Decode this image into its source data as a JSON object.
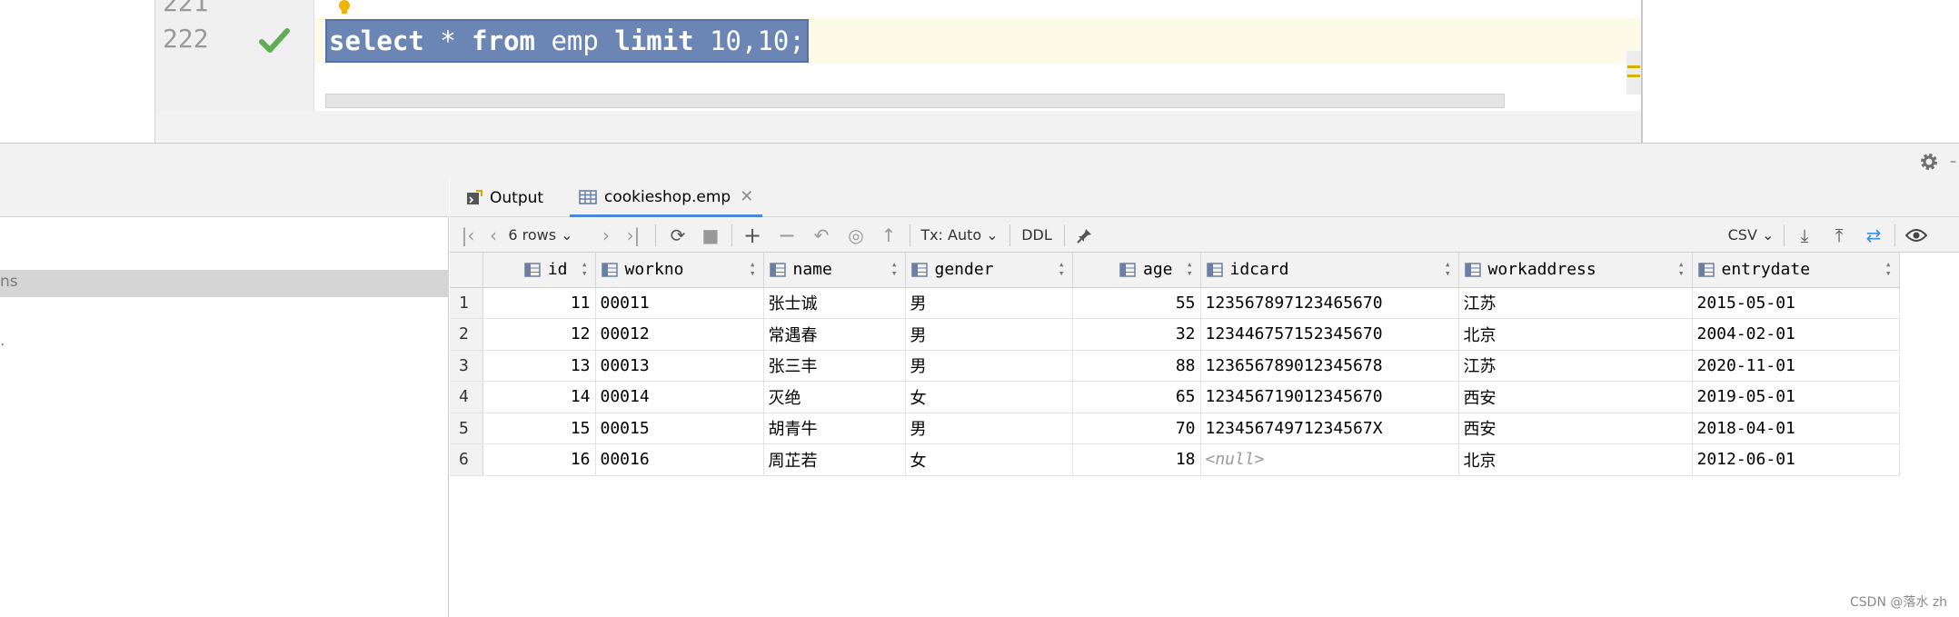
{
  "editor": {
    "line_prev": "221",
    "line_current": "222",
    "sql": {
      "kw_select": "select",
      "star": " * ",
      "kw_from": "from",
      "table": " emp ",
      "kw_limit": "limit",
      "args": " 10,10",
      "end": ";"
    }
  },
  "tabs": {
    "output": "Output",
    "result": "cookieshop.emp",
    "close": "✕"
  },
  "toolbar": {
    "rows": "6 rows",
    "tx": "Tx: Auto",
    "ddl": "DDL",
    "csv": "CSV"
  },
  "left_panel": {
    "frag1": "ns",
    "frag2": "."
  },
  "table": {
    "columns": [
      "id",
      "workno",
      "name",
      "gender",
      "age",
      "idcard",
      "workaddress",
      "entrydate"
    ],
    "rows": [
      {
        "n": "1",
        "id": "11",
        "workno": "00011",
        "name": "张士诚",
        "gender": "男",
        "age": "55",
        "idcard": "123567897123465670",
        "workaddress": "江苏",
        "entrydate": "2015-05-01"
      },
      {
        "n": "2",
        "id": "12",
        "workno": "00012",
        "name": "常遇春",
        "gender": "男",
        "age": "32",
        "idcard": "123446757152345670",
        "workaddress": "北京",
        "entrydate": "2004-02-01"
      },
      {
        "n": "3",
        "id": "13",
        "workno": "00013",
        "name": "张三丰",
        "gender": "男",
        "age": "88",
        "idcard": "123656789012345678",
        "workaddress": "江苏",
        "entrydate": "2020-11-01"
      },
      {
        "n": "4",
        "id": "14",
        "workno": "00014",
        "name": "灭绝",
        "gender": "女",
        "age": "65",
        "idcard": "123456719012345670",
        "workaddress": "西安",
        "entrydate": "2019-05-01"
      },
      {
        "n": "5",
        "id": "15",
        "workno": "00015",
        "name": "胡青牛",
        "gender": "男",
        "age": "70",
        "idcard": "12345674971234567X",
        "workaddress": "西安",
        "entrydate": "2018-04-01"
      },
      {
        "n": "6",
        "id": "16",
        "workno": "00016",
        "name": "周芷若",
        "gender": "女",
        "age": "18",
        "idcard": "<null>",
        "workaddress": "北京",
        "entrydate": "2012-06-01"
      }
    ]
  },
  "watermark": "CSDN @落水 zh",
  "colors": {
    "selection": "#6b86b5",
    "current_line": "#fdfbe8",
    "check": "#5fad55",
    "accent": "#4a88d6"
  }
}
